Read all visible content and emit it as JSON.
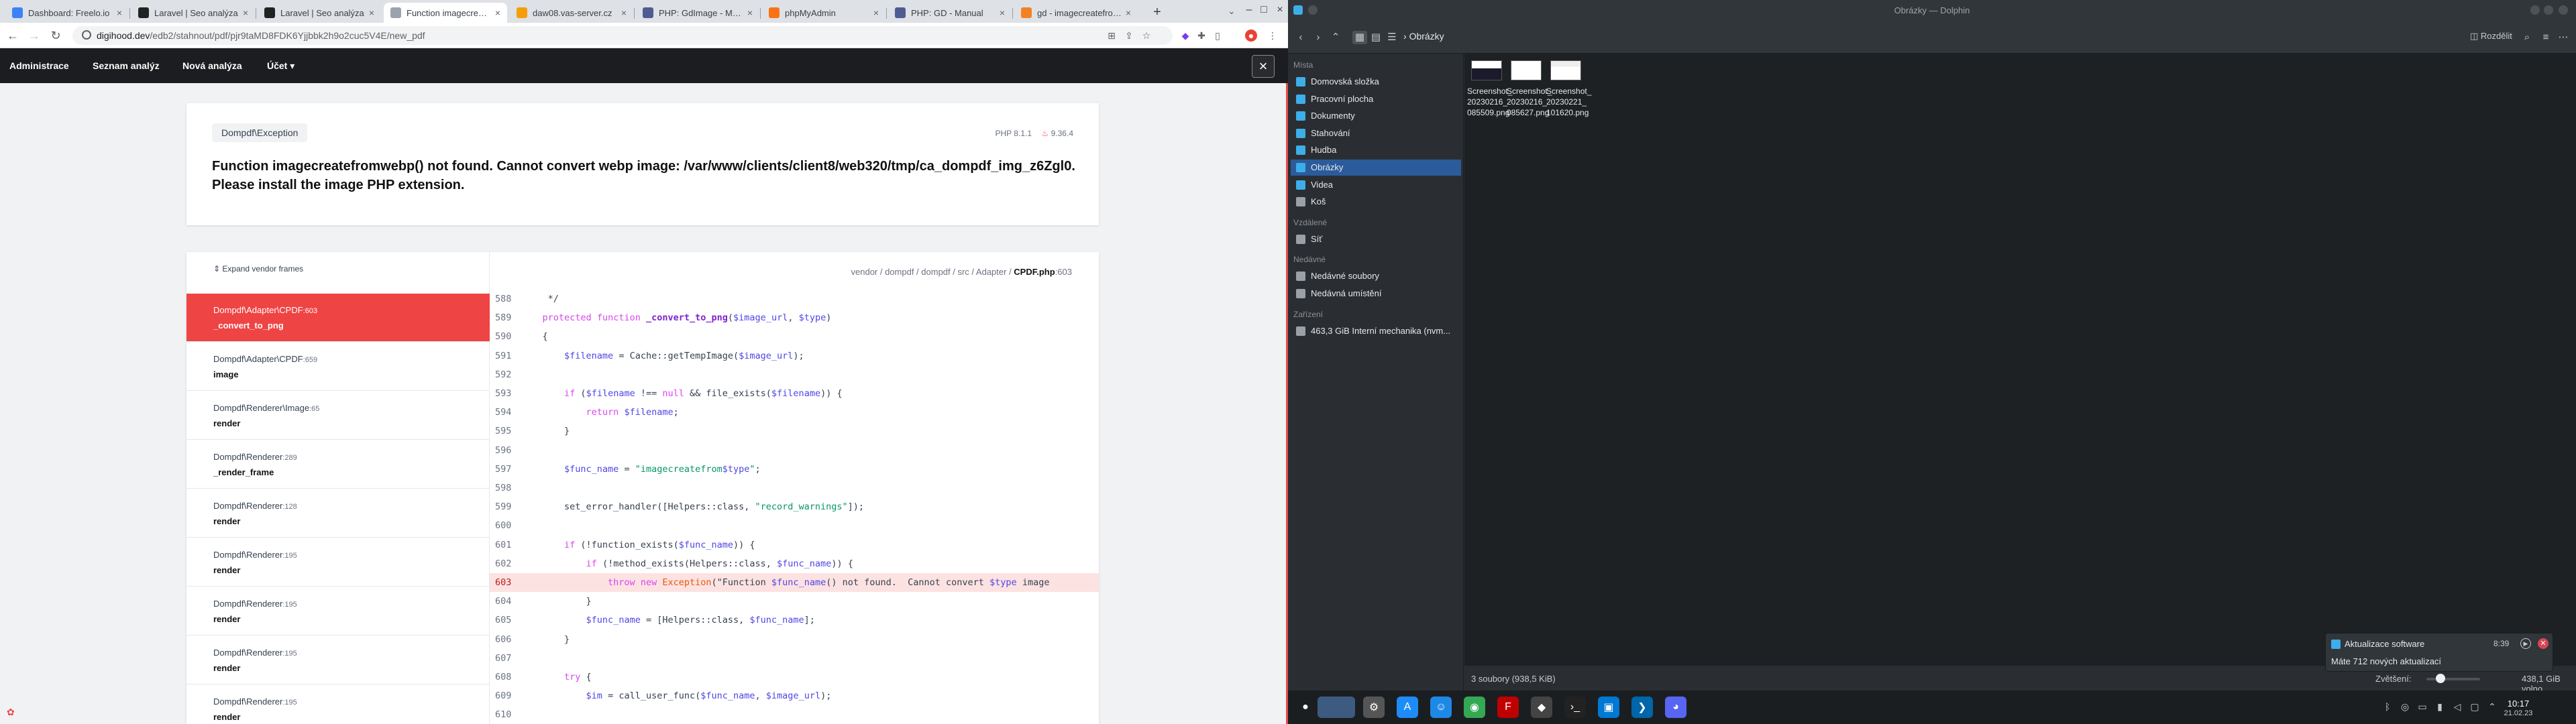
{
  "chrome": {
    "tabs": [
      {
        "label": "Dashboard: Freelo.io",
        "color": "#3b82f6"
      },
      {
        "label": "Laravel | Seo analýza",
        "color": "#222222"
      },
      {
        "label": "Laravel | Seo analýza",
        "color": "#222222"
      },
      {
        "label": "Function imagecreatef...",
        "color": "#9ca3af"
      },
      {
        "label": "daw08.vas-server.cz",
        "color": "#f59e0b"
      },
      {
        "label": "PHP: GdImage - Manu...",
        "color": "#4f5b93"
      },
      {
        "label": "phpMyAdmin",
        "color": "#f97316"
      },
      {
        "label": "PHP: GD - Manual",
        "color": "#4f5b93"
      },
      {
        "label": "gd - imagecreatefrom...",
        "color": "#f48024"
      }
    ],
    "new_tab": "+",
    "url_host": "digihood.dev",
    "url_path": "/edb2/stahnout/pdf/pjr9taMD8FDK6Yjjbbk2h9o2cuc5V4E/new_pdf"
  },
  "appnav": {
    "links": [
      "Administrace",
      "Seznam analýz",
      "Nová analýza",
      "Účet ▾"
    ],
    "close": "×"
  },
  "exception": {
    "class": "Dompdf\\Exception",
    "php_version": "PHP 8.1.1",
    "laravel_version": "9.36.4",
    "message": "Function imagecreatefromwebp() not found. Cannot convert webp image: /var/www/clients/client8/web320/tmp/ca_dompdf_img_z6Zgl0. Please install the image PHP extension."
  },
  "stack": {
    "expand_label": "Expand vendor frames",
    "file_path_prefix": "vendor / dompdf / dompdf / src / Adapter / ",
    "file_name": "CPDF.php",
    "file_line": ":603",
    "frames": [
      {
        "cls": "Dompdf\\Adapter\\CPDF",
        "line": ":603",
        "method": "_convert_to_png",
        "active": true
      },
      {
        "cls": "Dompdf\\Adapter\\CPDF",
        "line": ":659",
        "method": "image",
        "active": false
      },
      {
        "cls": "Dompdf\\Renderer\\Image",
        "line": ":65",
        "method": "render",
        "active": false
      },
      {
        "cls": "Dompdf\\Renderer",
        "line": ":289",
        "method": "_render_frame",
        "active": false
      },
      {
        "cls": "Dompdf\\Renderer",
        "line": ":128",
        "method": "render",
        "active": false
      },
      {
        "cls": "Dompdf\\Renderer",
        "line": ":195",
        "method": "render",
        "active": false
      },
      {
        "cls": "Dompdf\\Renderer",
        "line": ":195",
        "method": "render",
        "active": false
      },
      {
        "cls": "Dompdf\\Renderer",
        "line": ":195",
        "method": "render",
        "active": false
      },
      {
        "cls": "Dompdf\\Renderer",
        "line": ":195",
        "method": "render",
        "active": false
      }
    ],
    "code": [
      {
        "n": "588",
        "t": "     */"
      },
      {
        "n": "589",
        "t": "    protected function _convert_to_png($image_url, $type)"
      },
      {
        "n": "590",
        "t": "    {"
      },
      {
        "n": "591",
        "t": "        $filename = Cache::getTempImage($image_url);"
      },
      {
        "n": "592",
        "t": ""
      },
      {
        "n": "593",
        "t": "        if ($filename !== null && file_exists($filename)) {"
      },
      {
        "n": "594",
        "t": "            return $filename;"
      },
      {
        "n": "595",
        "t": "        }"
      },
      {
        "n": "596",
        "t": ""
      },
      {
        "n": "597",
        "t": "        $func_name = \"imagecreatefrom$type\";"
      },
      {
        "n": "598",
        "t": ""
      },
      {
        "n": "599",
        "t": "        set_error_handler([Helpers::class, \"record_warnings\"]);"
      },
      {
        "n": "600",
        "t": ""
      },
      {
        "n": "601",
        "t": "        if (!function_exists($func_name)) {"
      },
      {
        "n": "602",
        "t": "            if (!method_exists(Helpers::class, $func_name)) {"
      },
      {
        "n": "603",
        "t": "                throw new Exception(\"Function $func_name() not found.  Cannot convert $type image"
      },
      {
        "n": "604",
        "t": "            }"
      },
      {
        "n": "605",
        "t": "            $func_name = [Helpers::class, $func_name];"
      },
      {
        "n": "606",
        "t": "        }"
      },
      {
        "n": "607",
        "t": ""
      },
      {
        "n": "608",
        "t": "        try {"
      },
      {
        "n": "609",
        "t": "            $im = call_user_func($func_name, $image_url);"
      },
      {
        "n": "610",
        "t": ""
      }
    ],
    "highlight_line": "603"
  },
  "dolphin": {
    "title": "Obrázky — Dolphin",
    "breadcrumb": "Obrázky",
    "split_label": "Rozdělit",
    "places_header": "Místa",
    "remote_header": "Vzdálené",
    "recent_header": "Nedávné",
    "devices_header": "Zařízení",
    "places": [
      {
        "label": "Domovská složka",
        "color": "#3daee9"
      },
      {
        "label": "Pracovní plocha",
        "color": "#3daee9"
      },
      {
        "label": "Dokumenty",
        "color": "#3daee9"
      },
      {
        "label": "Stahování",
        "color": "#3daee9"
      },
      {
        "label": "Hudba",
        "color": "#3daee9"
      },
      {
        "label": "Obrázky",
        "color": "#3daee9"
      },
      {
        "label": "Videa",
        "color": "#3daee9"
      },
      {
        "label": "Koš",
        "color": "#9aa0a6"
      }
    ],
    "remote": [
      {
        "label": "Síť",
        "color": "#9aa0a6"
      }
    ],
    "recent": [
      {
        "label": "Nedávné soubory",
        "color": "#9aa0a6"
      },
      {
        "label": "Nedávná umístění",
        "color": "#9aa0a6"
      }
    ],
    "devices": [
      {
        "label": "463,3 GiB Interní mechanika (nvm...",
        "color": "#9aa0a6"
      }
    ],
    "files": [
      {
        "name": "Screenshot_\n20230216_\n085509.png",
        "thumb": "dark"
      },
      {
        "name": "Screenshot_\n20230216_\n085627.png",
        "thumb": "plain"
      },
      {
        "name": "Screenshot_\n20230221_\n101620.png",
        "thumb": "pink"
      }
    ],
    "status_left": "3 soubory (938,5 KiB)",
    "zoom_label": "Zvětšení:",
    "zoom_level": 0.15,
    "free_space": "438,1 GiB volno"
  },
  "notification": {
    "title": "Aktualizace software",
    "time": "8:39",
    "message": "Máte 712 nových aktualizací"
  },
  "taskbar": {
    "time": "10:17",
    "date": "21.02.23"
  }
}
